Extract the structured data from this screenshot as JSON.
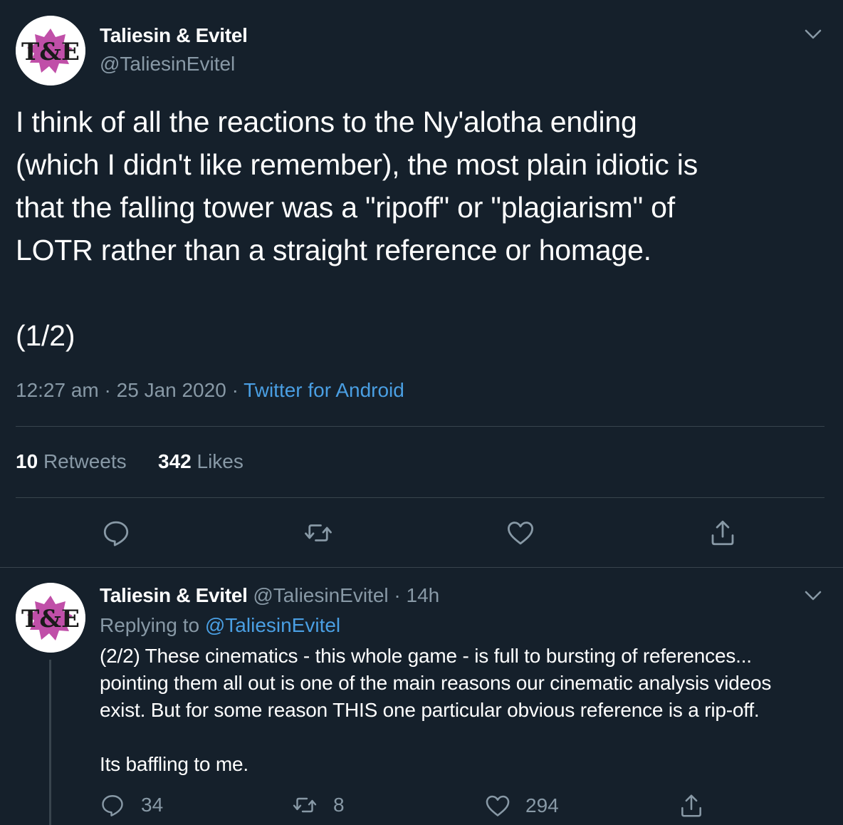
{
  "main_tweet": {
    "display_name": "Taliesin & Evitel",
    "handle": "@TaliesinEvitel",
    "avatar_text": "T&E",
    "text": "I think of all the reactions to the Ny'alotha ending\n(which I didn't like remember), the most plain idiotic is\nthat the falling tower was a \"ripoff\" or \"plagiarism\" of\nLOTR rather than a straight reference or homage.\n\n(1/2)",
    "time": "12:27 am",
    "date": "25 Jan 2020",
    "separator": "·",
    "source": "Twitter for Android",
    "retweets_count": "10",
    "retweets_label": "Retweets",
    "likes_count": "342",
    "likes_label": "Likes"
  },
  "reply_tweet": {
    "display_name": "Taliesin & Evitel",
    "handle": "@TaliesinEvitel",
    "separator": "·",
    "age": "14h",
    "replying_label": "Replying to",
    "replying_handle": "@TaliesinEvitel",
    "text": "(2/2) These cinematics - this whole game - is full to bursting of references...\npointing them all out is one of the main reasons our cinematic analysis videos\nexist. But for some reason THIS one particular obvious reference is a rip-off.\n\nIts baffling to me.",
    "reply_count": "34",
    "retweet_count": "8",
    "like_count": "294"
  },
  "colors": {
    "background": "#15202b",
    "text": "#ffffff",
    "muted": "#8899a6",
    "link": "#4a9fe3",
    "divider": "#38444d",
    "avatar_accent": "#c04fa8"
  },
  "icons": [
    "chevron-down-icon",
    "reply-icon",
    "retweet-icon",
    "like-icon",
    "share-icon"
  ]
}
